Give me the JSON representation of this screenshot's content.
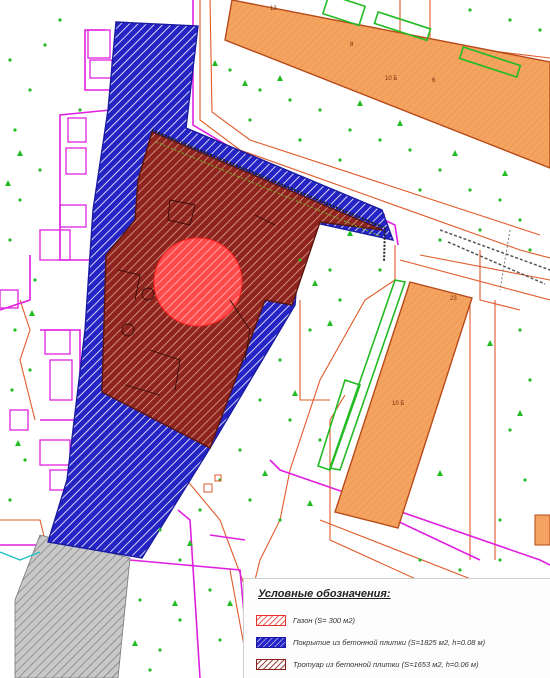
{
  "legend": {
    "title": "Условные обозначения:",
    "items": [
      {
        "label": "Газон (S= 300 м2)",
        "color": "#e8302a",
        "pattern": "red-hatch"
      },
      {
        "label": "Покрытие из бетонной плитки (S=1825 м2, h=0.08 м)",
        "color": "#2323c8",
        "pattern": "blue-hatch"
      },
      {
        "label": "Тротуар из бетонной плитки (S=1653 м2, h=0.06 м)",
        "color": "#8a1f1a",
        "pattern": "brown-hatch"
      }
    ]
  },
  "buildings": {
    "top_right": {
      "labels": [
        "13",
        "8",
        "10 Б",
        "6"
      ]
    },
    "right": {
      "labels": [
        "23",
        "10 Б"
      ]
    }
  },
  "colors": {
    "blue_zone": "#2323c8",
    "brown_zone": "#8a1f1a",
    "red_lawn": "#ff4a4a",
    "building_fill": "#f4a460",
    "building_stroke": "#b84a1a",
    "road_line": "#e05a2a",
    "magenta_line": "#e020e0",
    "green": "#22bb22",
    "gray_zone": "#888888"
  }
}
